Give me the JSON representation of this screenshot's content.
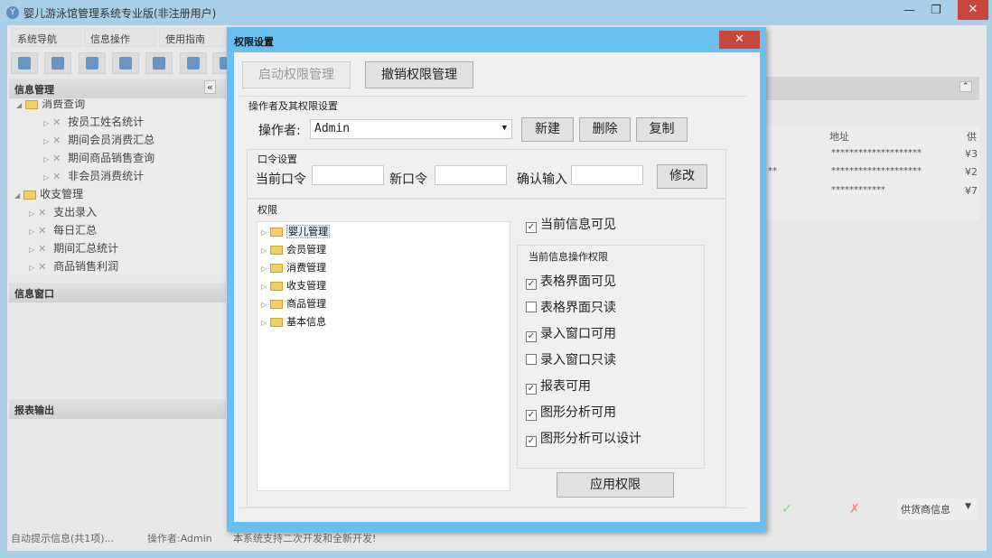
{
  "app": {
    "title": "婴儿游泳馆管理系统专业版(非注册用户)",
    "logo": "Y"
  },
  "tabs": [
    {
      "label": "系统导航"
    },
    {
      "label": "信息操作"
    },
    {
      "label": "使用指南"
    }
  ],
  "sidebar": {
    "info_header": "信息管理",
    "collapse_icon": "«",
    "tree": [
      {
        "label": "消费查询",
        "level": 0
      },
      {
        "label": "按员工姓名统计",
        "level": 1
      },
      {
        "label": "期间会员消费汇总",
        "level": 1
      },
      {
        "label": "期间商品销售查询",
        "level": 1
      },
      {
        "label": "非会员消费统计",
        "level": 1
      },
      {
        "label": "收支管理",
        "level": 0
      },
      {
        "label": "支出录入",
        "level": 1
      },
      {
        "label": "每日汇总",
        "level": 1
      },
      {
        "label": "期间汇总统计",
        "level": 1
      },
      {
        "label": "商品销售利润",
        "level": 1
      }
    ],
    "window_header": "信息窗口",
    "report_header": "报表输出"
  },
  "grid": {
    "columns": [
      "地址",
      "供"
    ],
    "rows": [
      [
        "********************",
        "¥3"
      ],
      [
        "**",
        "********************",
        "¥2"
      ],
      [
        "************",
        "¥7"
      ]
    ]
  },
  "bottom": {
    "confirm": "✓",
    "cancel": "✗",
    "select": "供货商信息"
  },
  "status": {
    "hint": "自动提示信息(共1项)...",
    "operator": "操作者:Admin",
    "note": "本系统支持二次开发和全新开发!"
  },
  "dialog": {
    "title": "权限设置",
    "close": "✕",
    "enable_btn": "启动权限管理",
    "revoke_btn": "撤销权限管理",
    "operator_section": "操作者及其权限设置",
    "operator_label": "操作者:",
    "operator_value": "Admin",
    "new_btn": "新建",
    "delete_btn": "删除",
    "copy_btn": "复制",
    "pwd_section": "口令设置",
    "current_pwd": "当前口令",
    "new_pwd": "新口令",
    "confirm_pwd": "确认输入",
    "modify_btn": "修改",
    "perm_section": "权限",
    "perm_tree": [
      "婴儿管理",
      "会员管理",
      "消费管理",
      "收支管理",
      "商品管理",
      "基本信息"
    ],
    "visible": {
      "label": "当前信息可见",
      "checked": true
    },
    "ops_section": "当前信息操作权限",
    "ops": [
      {
        "label": "表格界面可见",
        "checked": true
      },
      {
        "label": "表格界面只读",
        "checked": false
      },
      {
        "label": "录入窗口可用",
        "checked": true
      },
      {
        "label": "录入窗口只读",
        "checked": false
      },
      {
        "label": "报表可用",
        "checked": true
      },
      {
        "label": "图形分析可用",
        "checked": true
      },
      {
        "label": "图形分析可以设计",
        "checked": true
      }
    ],
    "apply_btn": "应用权限"
  }
}
